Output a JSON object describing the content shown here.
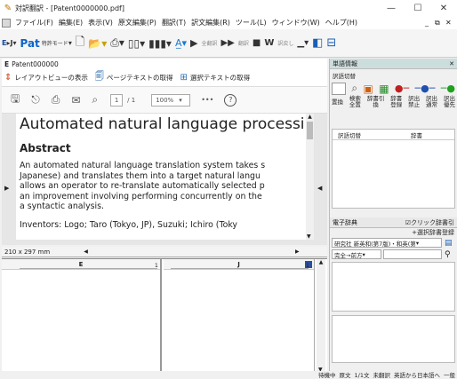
{
  "window": {
    "title": "対訳翻訳 - [Patent0000000.pdf]"
  },
  "menu": [
    "ファイル(F)",
    "編集(E)",
    "表示(V)",
    "原文編集(P)",
    "翻訳(T)",
    "訳文編集(R)",
    "ツール(L)",
    "ウィンドウ(W)",
    "ヘルプ(H)"
  ],
  "toolbar": {
    "mode_label": "特許モード",
    "translate_all": "全翻訳",
    "translate": "翻訳",
    "translate_back": "訳戻し"
  },
  "doc": {
    "tab_label": "Patent000000",
    "layout_view": "レイアウトビューの表示",
    "get_page_text": "ページテキストの取得",
    "get_selected_text": "選択テキストの取得",
    "page_current": "1",
    "page_total": "/ 1",
    "zoom": "100%",
    "more": "•••",
    "help": "?"
  },
  "pdf": {
    "title": "Automated natural language processin",
    "abstract_heading": "Abstract",
    "abstract_lines": [
      "An automated natural language translation system takes s",
      "Japanese) and translates them into a target natural langu",
      "allows an operator to re-translate automatically selected p",
      "an improvement involving performing concurrently on the",
      "a syntactic analysis."
    ],
    "inventors": "Inventors:   Logo; Taro (Tokyo, JP), Suzuki; Ichiro (Toky",
    "page_size": "210 x 297 mm"
  },
  "panes": {
    "left_header": "E",
    "right_header": "J",
    "left_line_no": "1",
    "right_line_no": "1"
  },
  "right_panel": {
    "title": "単語情報",
    "group_label": "訳語切替",
    "tools": [
      {
        "top": "置換",
        "bottom": ""
      },
      {
        "top": "検索",
        "bottom": "全置"
      },
      {
        "top": "辞書引",
        "bottom": "換"
      },
      {
        "top": "辞書",
        "bottom": "登録"
      },
      {
        "top": "訳出",
        "bottom": "禁止"
      },
      {
        "top": "訳出",
        "bottom": "通常"
      },
      {
        "top": "訳出",
        "bottom": "優先"
      }
    ],
    "table_col1": "訳語切替",
    "table_col2": "辞書",
    "ejdict_title": "電子辞典",
    "click_lookup": "クリック辞書引",
    "register_selected": "+選択辞書登録",
    "dict_name": "研究社 新英和(第7版)・和英(第",
    "search_mode": "完全→前方"
  },
  "status": {
    "items": [
      "待機中",
      "原文",
      "1/1文",
      "未翻訳",
      "英語から日本語へ",
      "一般"
    ]
  }
}
